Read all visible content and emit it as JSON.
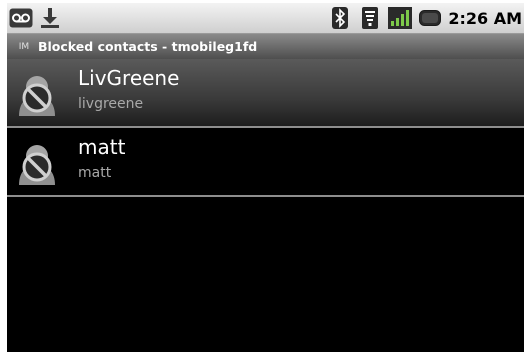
{
  "status_bar": {
    "time": "2:26 AM",
    "left_icons": [
      "voicemail-icon",
      "download-icon"
    ],
    "right_icons": [
      "bluetooth-icon",
      "wifi-icon",
      "signal-icon",
      "battery-icon"
    ]
  },
  "title_bar": {
    "app_icon": "im-icon",
    "app_icon_text": "IM",
    "title": "Blocked contacts - tmobileg1fd"
  },
  "contacts": [
    {
      "name": "LivGreene",
      "username": "livgreene",
      "selected": true
    },
    {
      "name": "matt",
      "username": "matt",
      "selected": false
    }
  ],
  "colors": {
    "background": "#000000",
    "title_bar": "#6a6a6a",
    "divider": "#8e8e8e",
    "username_text": "#a9a9a9"
  }
}
